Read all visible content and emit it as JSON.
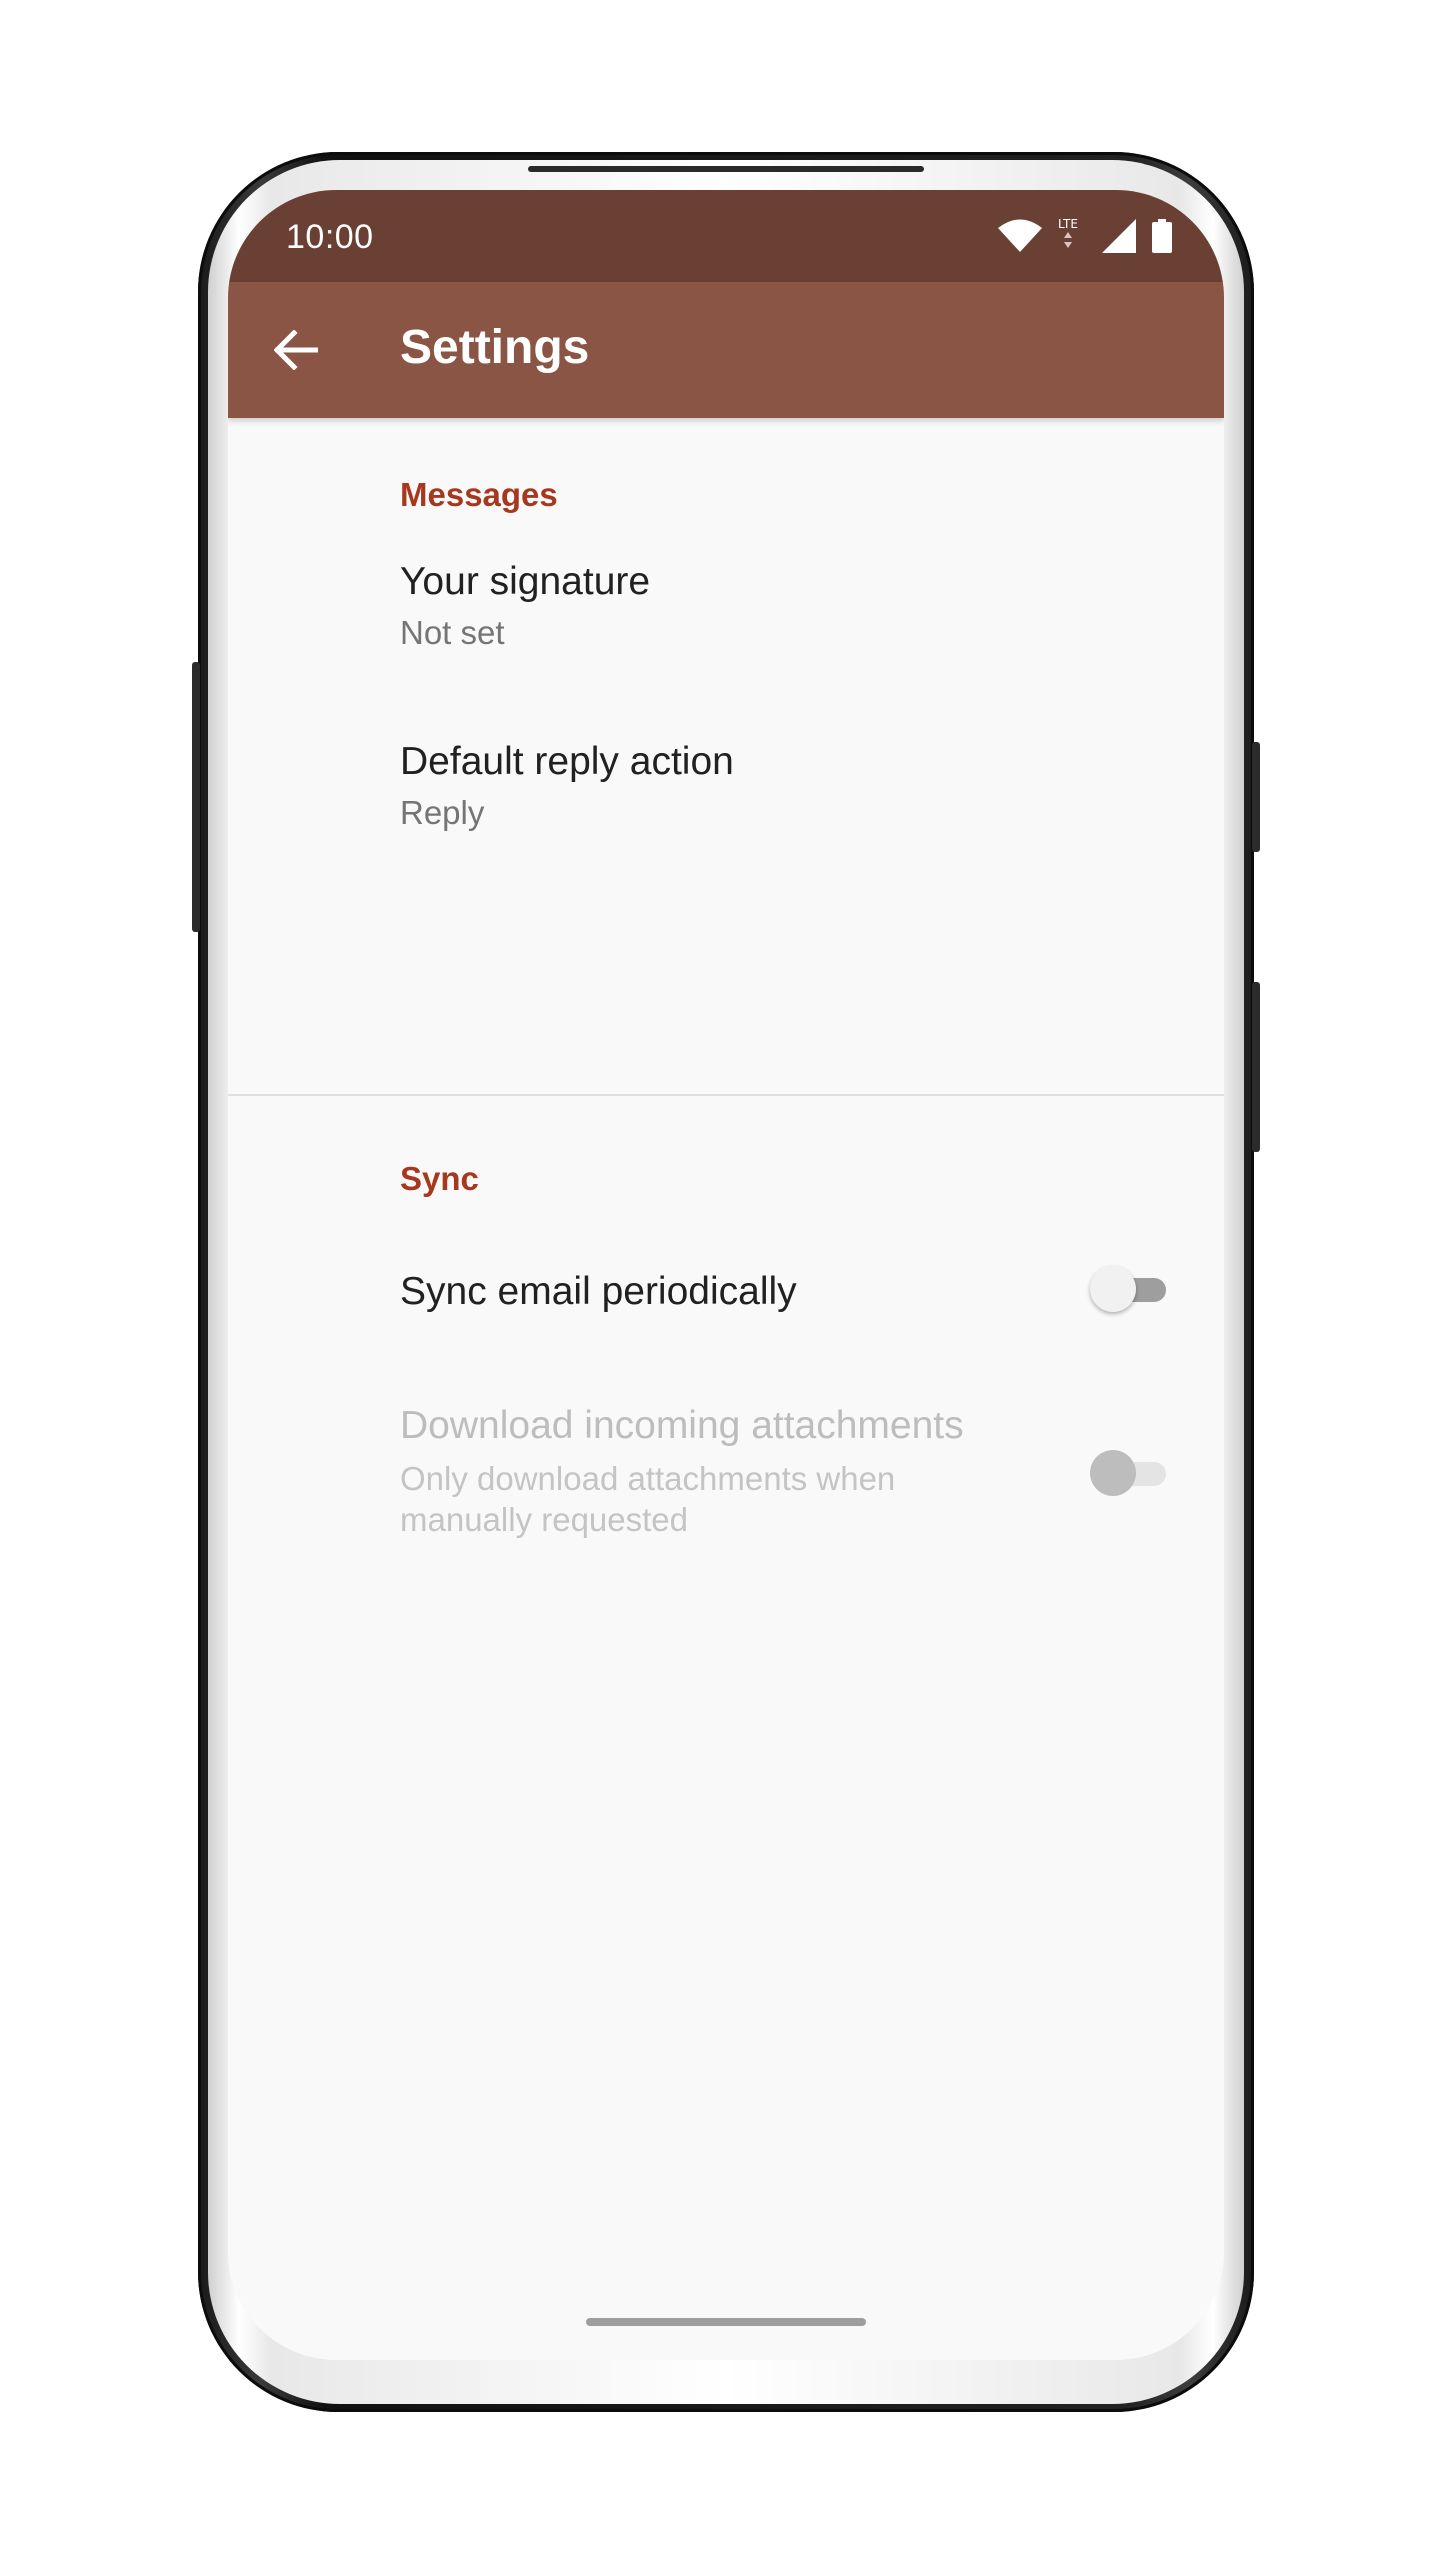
{
  "status_bar": {
    "time": "10:00",
    "network_label": "LTE",
    "icons": [
      "wifi-icon",
      "lte-icon",
      "cell-signal-icon",
      "battery-icon"
    ]
  },
  "app_bar": {
    "title": "Settings",
    "back_icon": "arrow-back-icon"
  },
  "sections": {
    "messages": {
      "header": "Messages",
      "signature": {
        "title": "Your signature",
        "summary": "Not set"
      },
      "reply": {
        "title": "Default reply action",
        "summary": "Reply"
      }
    },
    "sync": {
      "header": "Sync",
      "sync_periodic": {
        "title": "Sync email periodically",
        "enabled": false
      },
      "download_attachments": {
        "title": "Download incoming attachments",
        "summary": "Only download attachments when manually requested",
        "enabled": false,
        "disabled": true
      }
    }
  },
  "colors": {
    "status_bar": "#6b4034",
    "app_bar": "#8b5546",
    "accent": "#a6381f",
    "background": "#f9f9f9"
  }
}
